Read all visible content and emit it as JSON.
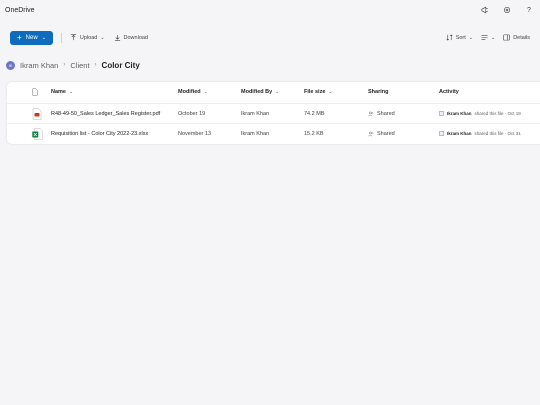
{
  "app": {
    "title": "OneDrive"
  },
  "topbar": {
    "icons": [
      "megaphone-icon",
      "settings-icon",
      "help-icon"
    ],
    "help_glyph": "?"
  },
  "toolbar": {
    "new_label": "New",
    "upload_label": "Upload",
    "download_label": "Download",
    "sort_label": "Sort",
    "details_label": "Details"
  },
  "breadcrumb": {
    "avatar_initials": "IK",
    "items": [
      "Ikram Khan",
      "Client",
      "Color City"
    ],
    "separator": "›"
  },
  "table": {
    "columns": [
      "Name",
      "Modified",
      "Modified By",
      "File size",
      "Sharing",
      "Activity"
    ],
    "rows": [
      {
        "name": "R48-49-50_Sales Ledger_Sales Register.pdf",
        "type": "pdf",
        "modified": "October 19",
        "modified_by": "Ikram Khan",
        "size": "74.2 MB",
        "sharing": "Shared",
        "activity_user": "Ikram Khan",
        "activity_text": "shared this file · Oct 19"
      },
      {
        "name": "Requisition list - Color City 2022-23.xlsx",
        "type": "xlsx",
        "modified": "November 13",
        "modified_by": "Ikram Khan",
        "size": "15.2 KB",
        "sharing": "Shared",
        "activity_user": "Ikram Khan",
        "activity_text": "shared this file · Oct 31"
      }
    ]
  },
  "colors": {
    "accent": "#0f6cbd",
    "avatar": "#6e73c6",
    "pdf": "#c43e1c",
    "excel": "#107c41"
  }
}
